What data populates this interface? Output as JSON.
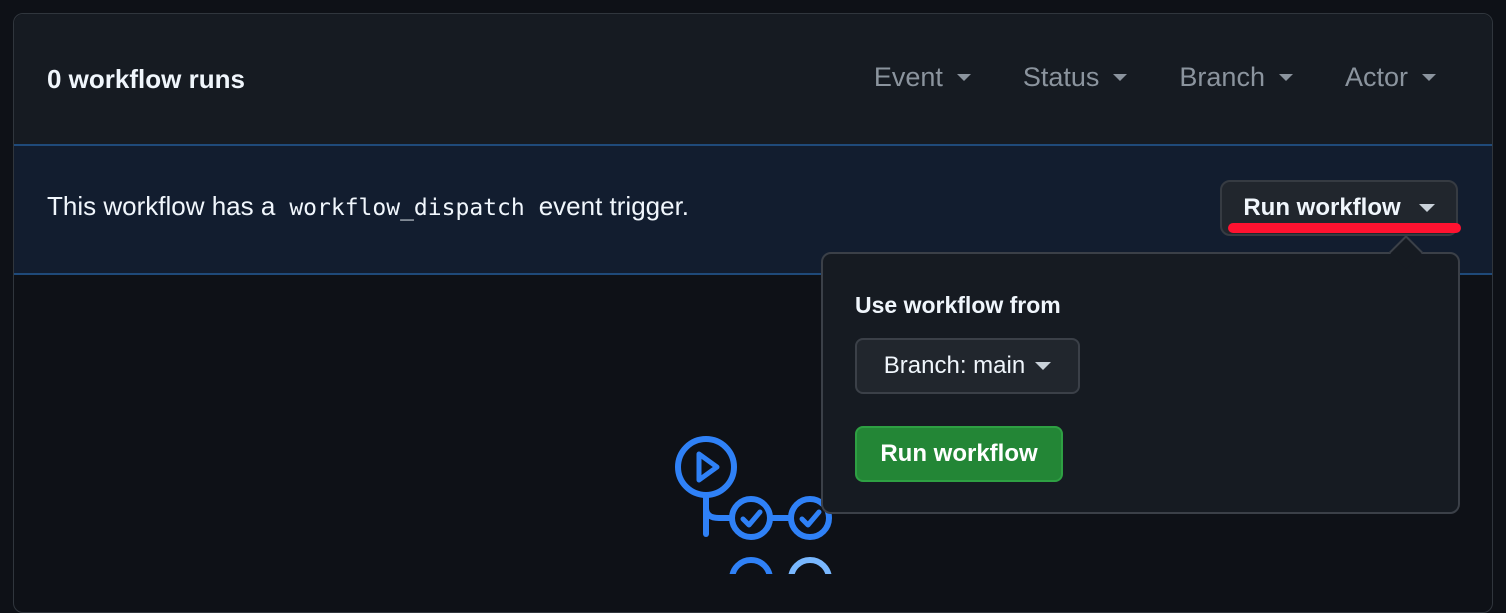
{
  "header": {
    "title": "0 workflow runs",
    "filters": [
      {
        "label": "Event"
      },
      {
        "label": "Status"
      },
      {
        "label": "Branch"
      },
      {
        "label": "Actor"
      }
    ]
  },
  "banner": {
    "text_before": "This workflow has a",
    "code": "workflow_dispatch",
    "text_after": "event trigger.",
    "run_button_label": "Run workflow"
  },
  "popover": {
    "label": "Use workflow from",
    "branch_select": "Branch: main",
    "submit_label": "Run workflow"
  },
  "colors": {
    "accent_blue": "#2f81f7",
    "button_green": "#238636",
    "highlight_red": "#ff1230"
  },
  "icons": {
    "empty_state": "github-actions-icon"
  }
}
